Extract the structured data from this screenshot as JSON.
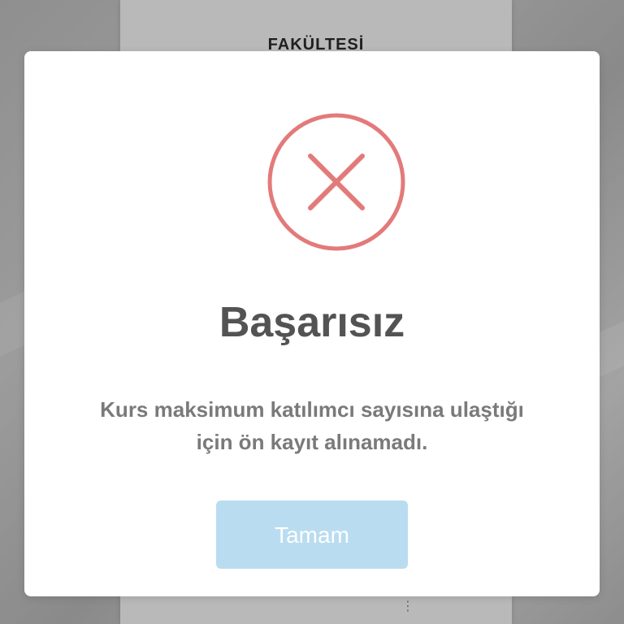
{
  "background": {
    "page_heading": "FAKÜLTESİ",
    "page_more_glyph": "⋮"
  },
  "dialog": {
    "icon": "error-x-circle-icon",
    "icon_color": "#e37a7a",
    "title": "Başarısız",
    "message_line1": "Kurs maksimum katılımcı sayısına ulaştığı",
    "message_line2": "için ön kayıt alınamadı.",
    "ok_button_label": "Tamam",
    "ok_button_color": "#b9dcf1"
  }
}
